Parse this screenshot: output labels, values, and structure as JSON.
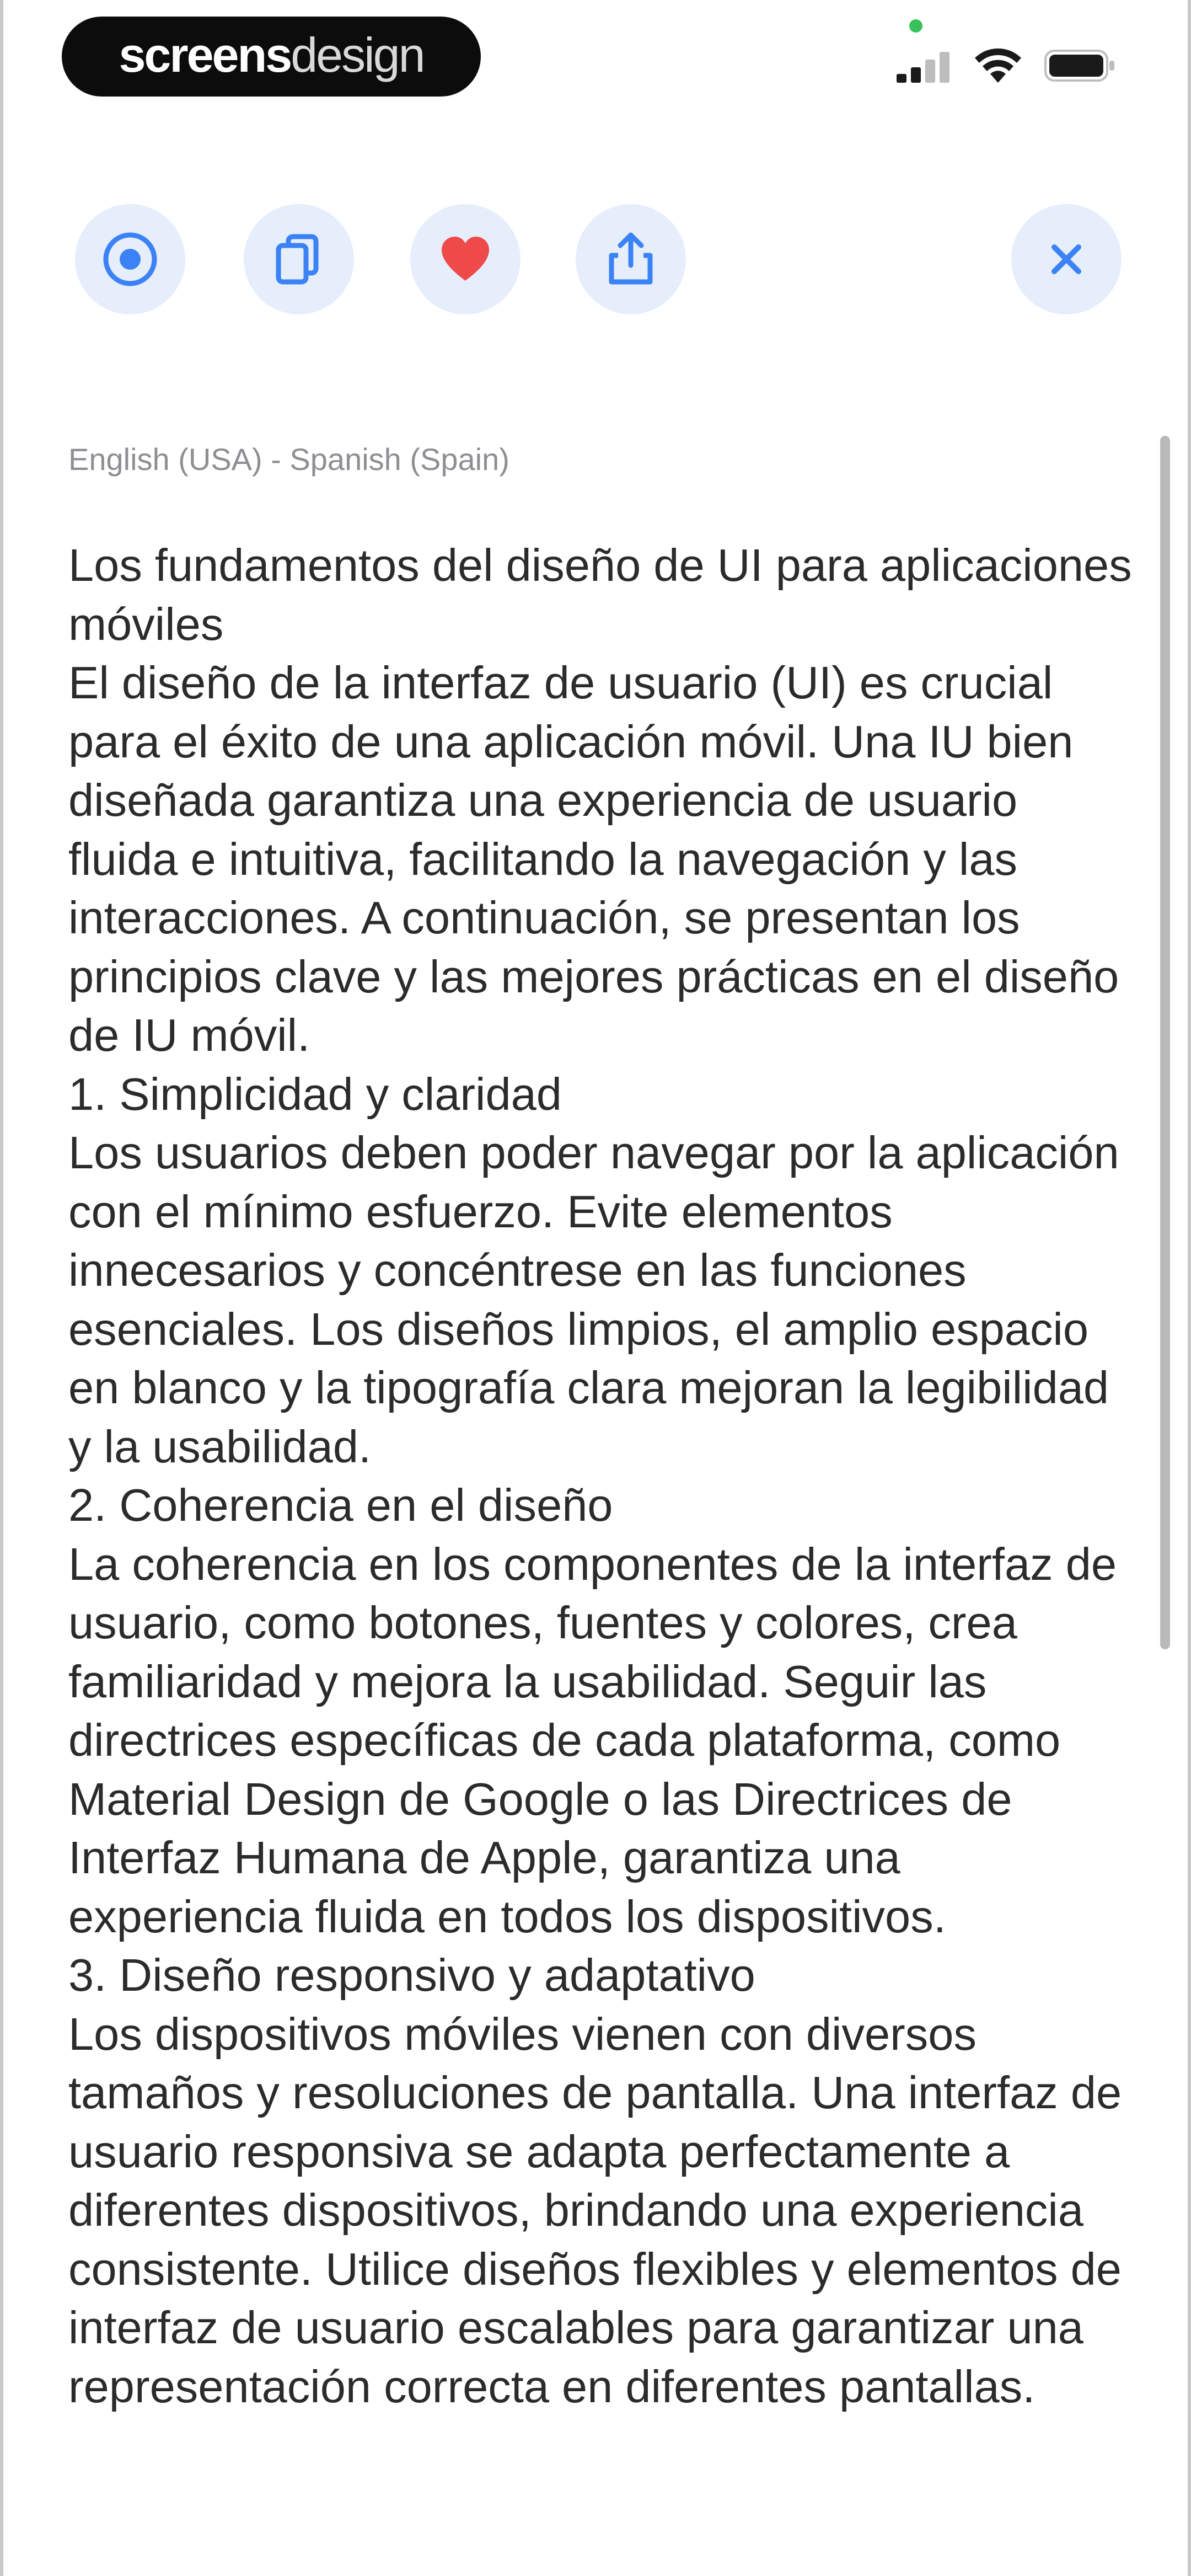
{
  "status_bar": {
    "brand_bold": "screens",
    "brand_light": "design",
    "icons": [
      "cellular-signal-icon",
      "wifi-icon",
      "battery-icon"
    ],
    "accent_dot_color": "#39c15b"
  },
  "toolbar": {
    "buttons": [
      {
        "name": "play-button",
        "icon": "play-circle-icon"
      },
      {
        "name": "copy-button",
        "icon": "copy-icon"
      },
      {
        "name": "favorite-button",
        "icon": "heart-icon"
      },
      {
        "name": "share-button",
        "icon": "share-icon"
      },
      {
        "name": "close-button",
        "icon": "close-icon"
      }
    ],
    "icon_color": "#3b82f6",
    "heart_color": "#ef4a4a",
    "button_bg": "#e6eefc"
  },
  "translation": {
    "language_pair": "English (USA) - Spanish (Spain)",
    "paragraphs": [
      "Los fundamentos del diseño de UI para aplicaciones móviles",
      "El diseño de la interfaz de usuario (UI) es crucial para el éxito de una aplicación móvil. Una IU bien diseñada garantiza una experiencia de usuario fluida e intuitiva, facilitando la navegación y las interacciones. A continuación, se presentan los principios clave y las mejores prácticas en el diseño de IU móvil.",
      "1. Simplicidad y claridad",
      "Los usuarios deben poder navegar por la aplicación con el mínimo esfuerzo. Evite elementos innecesarios y concéntrese en las funciones esenciales. Los diseños limpios, el amplio espacio en blanco y la tipografía clara mejoran la legibilidad y la usabilidad.",
      "2. Coherencia en el diseño",
      "La coherencia en los componentes de la interfaz de usuario, como botones, fuentes y colores, crea familiaridad y mejora la usabilidad. Seguir las directrices específicas de cada plataforma, como Material Design de Google o las Directrices de Interfaz Humana de Apple, garantiza una experiencia fluida en todos los dispositivos.",
      "3. Diseño responsivo y adaptativo",
      "Los dispositivos móviles vienen con diversos tamaños y resoluciones de pantalla. Una interfaz de usuario responsiva se adapta perfectamente a diferentes dispositivos, brindando una experiencia consistente. Utilice diseños flexibles y elementos de interfaz de usuario escalables para garantizar una representación correcta en diferentes pantallas."
    ]
  }
}
